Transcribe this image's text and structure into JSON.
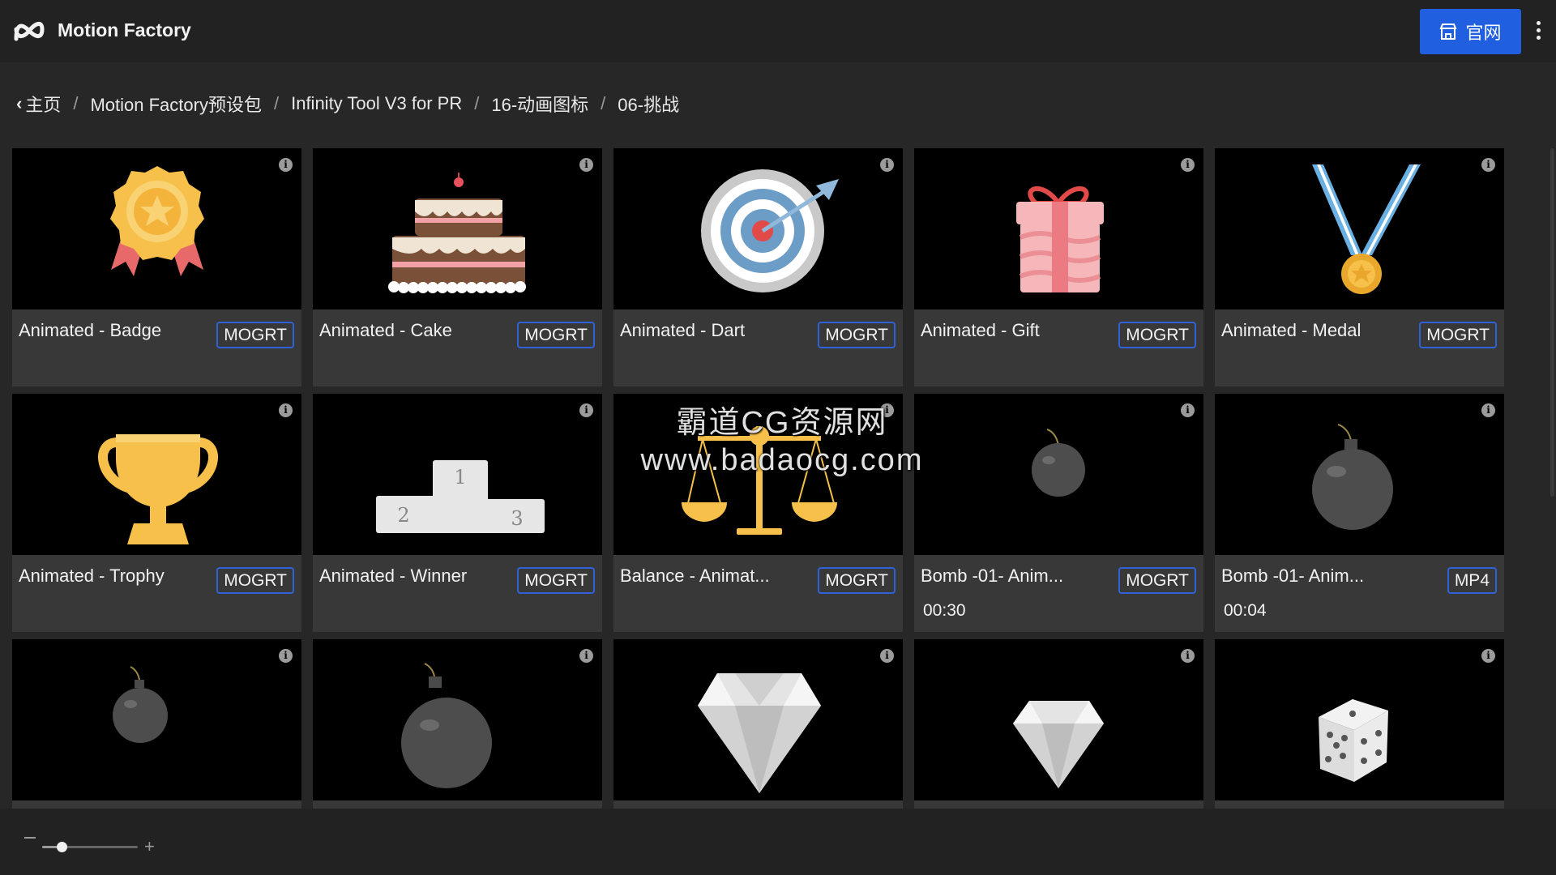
{
  "app": {
    "title": "Motion Factory",
    "site_button_label": "官网",
    "accent_color": "#1f5fe0"
  },
  "breadcrumb": [
    {
      "label": "主页"
    },
    {
      "label": "Motion Factory预设包"
    },
    {
      "label": "Infinity Tool V3 for PR"
    },
    {
      "label": "16-动画图标"
    },
    {
      "label": "06-挑战"
    }
  ],
  "grid": {
    "cards": [
      {
        "title": "Animated - Badge",
        "format": "MOGRT",
        "duration": "",
        "icon": "badge-icon"
      },
      {
        "title": "Animated - Cake",
        "format": "MOGRT",
        "duration": "",
        "icon": "cake-icon"
      },
      {
        "title": "Animated - Dart",
        "format": "MOGRT",
        "duration": "",
        "icon": "dart-icon"
      },
      {
        "title": "Animated - Gift",
        "format": "MOGRT",
        "duration": "",
        "icon": "gift-icon"
      },
      {
        "title": "Animated - Medal",
        "format": "MOGRT",
        "duration": "",
        "icon": "medal-icon"
      },
      {
        "title": "Animated - Trophy",
        "format": "MOGRT",
        "duration": "",
        "icon": "trophy-icon"
      },
      {
        "title": "Animated - Winner",
        "format": "MOGRT",
        "duration": "",
        "icon": "podium-icon",
        "podium_numbers": [
          "1",
          "2",
          "3"
        ]
      },
      {
        "title": "Balance - Animat...",
        "format": "MOGRT",
        "duration": "",
        "icon": "balance-icon"
      },
      {
        "title": "Bomb -01- Anim...",
        "format": "MOGRT",
        "duration": "00:30",
        "icon": "bomb-icon"
      },
      {
        "title": "Bomb -01- Anim...",
        "format": "MP4",
        "duration": "00:04",
        "icon": "bomb-icon"
      },
      {
        "title": "",
        "format": "",
        "duration": "",
        "icon": "bomb-icon"
      },
      {
        "title": "",
        "format": "",
        "duration": "",
        "icon": "bomb-icon"
      },
      {
        "title": "",
        "format": "",
        "duration": "",
        "icon": "diamond-icon"
      },
      {
        "title": "",
        "format": "",
        "duration": "",
        "icon": "diamond-icon"
      },
      {
        "title": "",
        "format": "",
        "duration": "",
        "icon": "dice-icon"
      }
    ]
  },
  "watermark": {
    "line1": "霸道CG资源网",
    "line2": "www.badaocg.com"
  },
  "zoom": {
    "level_fraction": 0.2
  }
}
